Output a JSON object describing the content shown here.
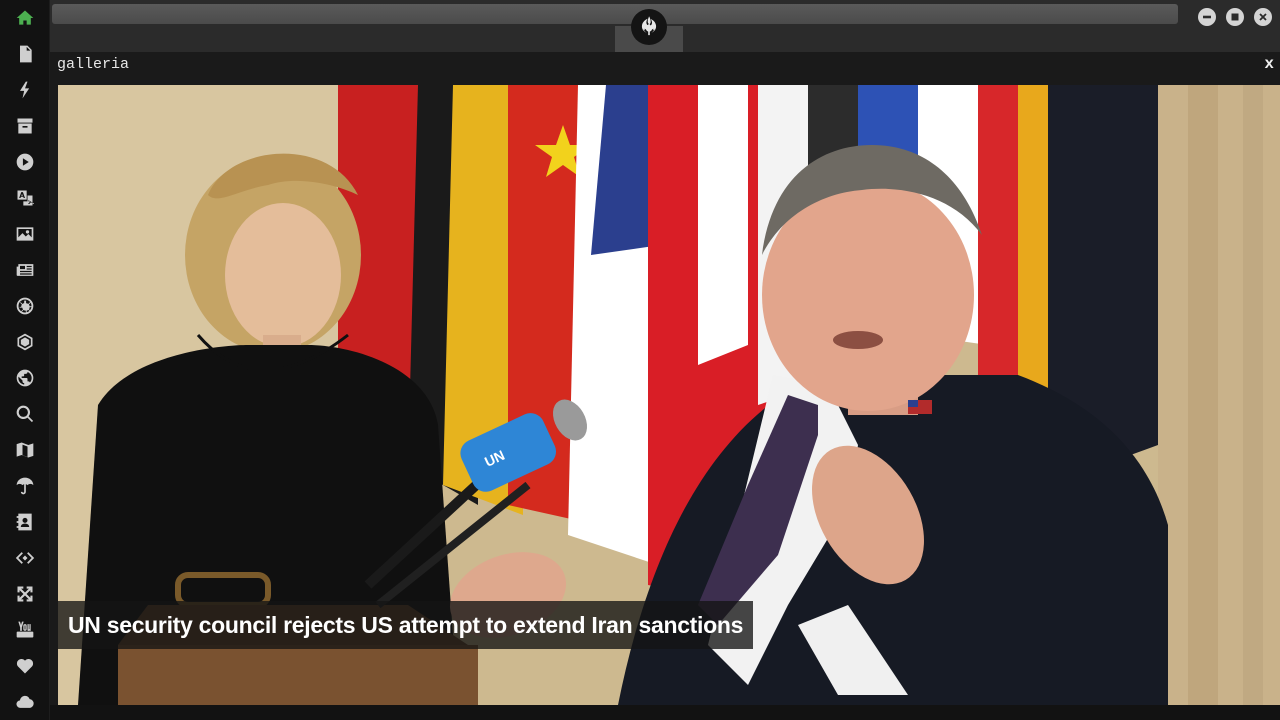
{
  "window": {
    "title": "galleria",
    "close_label": "x",
    "controls": [
      "minimize-icon",
      "maximize-icon",
      "close-icon"
    ]
  },
  "sidebar": {
    "active_color": "#4caf50",
    "items": [
      {
        "icon": "home-icon",
        "active": true
      },
      {
        "icon": "document-icon"
      },
      {
        "icon": "lightning-icon"
      },
      {
        "icon": "archive-icon"
      },
      {
        "icon": "play-icon"
      },
      {
        "icon": "translate-icon"
      },
      {
        "icon": "image-icon"
      },
      {
        "icon": "newspaper-icon"
      },
      {
        "icon": "empire-icon"
      },
      {
        "icon": "hexagon-icon"
      },
      {
        "icon": "globe-icon"
      },
      {
        "icon": "search-icon"
      },
      {
        "icon": "map-icon"
      },
      {
        "icon": "umbrella-icon"
      },
      {
        "icon": "contacts-icon"
      },
      {
        "icon": "code-icon"
      },
      {
        "icon": "expand-icon"
      },
      {
        "icon": "youtube-icon"
      },
      {
        "icon": "heart-icon"
      },
      {
        "icon": "cloud-icon"
      }
    ]
  },
  "header": {
    "logo_icon": "rebel-alliance-icon"
  },
  "gallery": {
    "caption": "UN security council rejects US attempt to extend Iran sanctions"
  }
}
